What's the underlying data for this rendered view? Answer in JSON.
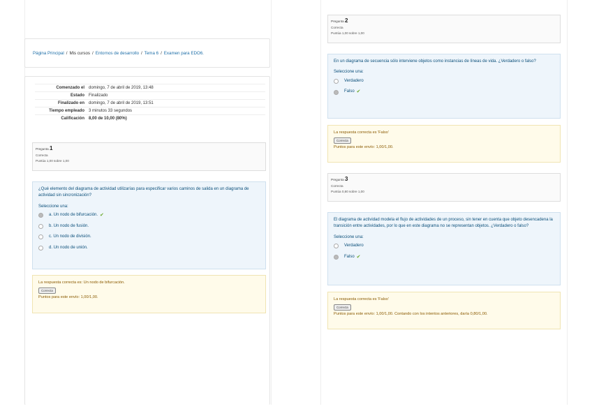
{
  "breadcrumb": [
    "Página Principal",
    "Mis cursos",
    "Entornos de desarrollo",
    "Tema 6",
    "Examen para EDO6."
  ],
  "summary": [
    {
      "k": "Comenzado el",
      "v": "domingo, 7 de abril de 2019, 13:48"
    },
    {
      "k": "Estado",
      "v": "Finalizado"
    },
    {
      "k": "Finalizado en",
      "v": "domingo, 7 de abril de 2019, 13:51"
    },
    {
      "k": "Tiempo empleado",
      "v": "3 minutos 33 segundos"
    },
    {
      "k": "Calificación",
      "v": "8,00 de 10,00 (80%)"
    }
  ],
  "q1": {
    "label": "Pregunta",
    "num": "1",
    "state": "Correcta",
    "points": "Puntúa 1,00 sobre 1,00",
    "text": "¿Qué elemento del diagrama de actividad utilizarías para especificar varios caminos de salida en un diagrama de actividad sin sincronización?",
    "prompt": "Seleccione una:",
    "options": [
      "a. Un nodo de bifurcación.",
      "b. Un nodo de fusión.",
      "c. Un nodo de división.",
      "d. Un nodo de unión."
    ],
    "feedback": "La respuesta correcta es: Un nodo de bifurcación.",
    "badge": "Correcta",
    "send_points": "Puntos para este envío: 1,00/1,00."
  },
  "q2": {
    "label": "Pregunta",
    "num": "2",
    "state": "Correcta",
    "points": "Puntúa 1,00 sobre 1,00",
    "text": "En un diagrama de secuencia sólo interviene objetos como instancias de líneas de vida. ¿Verdadero o falso?",
    "prompt": "Seleccione una:",
    "options": [
      "Verdadero",
      "Falso"
    ],
    "feedback": "La respuesta correcta es 'Falso'",
    "badge": "Correcta",
    "send_points": "Puntos para este envío: 1,00/1,00."
  },
  "q3": {
    "label": "Pregunta",
    "num": "3",
    "state": "Correcta",
    "points": "Puntúa 0,80 sobre 1,00",
    "text": "El diagrama de actividad modela el flujo de actividades de un proceso, sin tener en cuenta que objeto desencadena la transición entre actividades, por lo que en este diagrama no se representan objetos. ¿Verdadero o falso?",
    "prompt": "Seleccione una:",
    "options": [
      "Verdadero",
      "Falso"
    ],
    "feedback": "La respuesta correcta es 'Falso'",
    "badge": "Correcta",
    "send_points": "Puntos para este envío: 1,00/1,00. Contando con los intentos anteriores, daría 0,80/1,00."
  }
}
